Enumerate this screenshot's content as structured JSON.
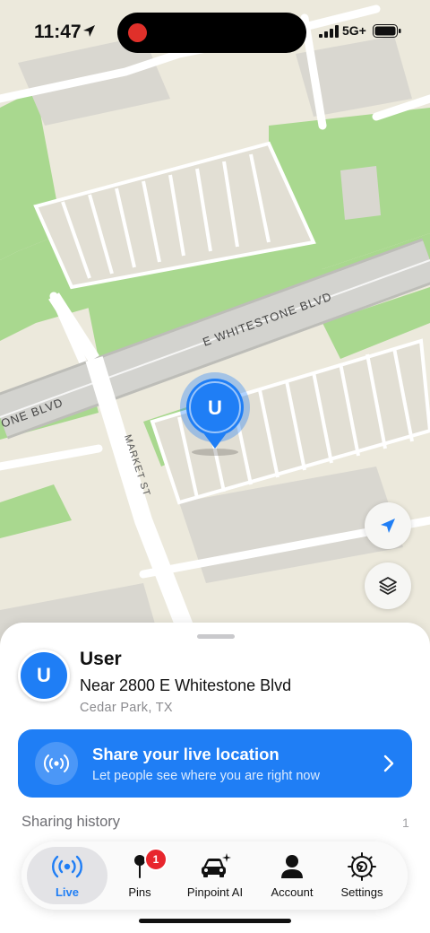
{
  "status_bar": {
    "time": "11:47",
    "network": "5G+",
    "recording_indicator": "red-dot",
    "icons": [
      "location-arrow-icon",
      "signal-bars-icon",
      "battery-icon"
    ]
  },
  "map": {
    "street_labels": [
      "E WHITESTONE BLVD",
      "E WHITESTONE BLVD",
      "MARKET ST"
    ],
    "user_marker_initial": "U",
    "colors": {
      "land": "#ece9dc",
      "park": "#a9d88f",
      "road": "#ffffff",
      "highway": "#c8c8c4",
      "building": "#d9d7d0",
      "marker": "#1f7ef5"
    },
    "buttons": {
      "locate": "location-arrow-icon",
      "layers": "layers-icon"
    }
  },
  "sheet": {
    "user": {
      "initial": "U",
      "name": "User",
      "address": "Near 2800 E Whitestone Blvd",
      "city": "Cedar Park, TX"
    },
    "share_card": {
      "title": "Share your live location",
      "subtitle": "Let people see where you are right now",
      "icon": "broadcast-icon",
      "color": "#1f7ef5"
    },
    "history": {
      "label": "Sharing history",
      "count": "1"
    }
  },
  "tabbar": {
    "tabs": [
      {
        "label": "Live",
        "icon": "broadcast-icon",
        "active": true
      },
      {
        "label": "Pins",
        "icon": "pin-icon",
        "badge": "1"
      },
      {
        "label": "Pinpoint AI",
        "icon": "car-sparkle-icon"
      },
      {
        "label": "Account",
        "icon": "person-icon"
      },
      {
        "label": "Settings",
        "icon": "gear-icon"
      }
    ],
    "active_color": "#1f7ef5"
  }
}
